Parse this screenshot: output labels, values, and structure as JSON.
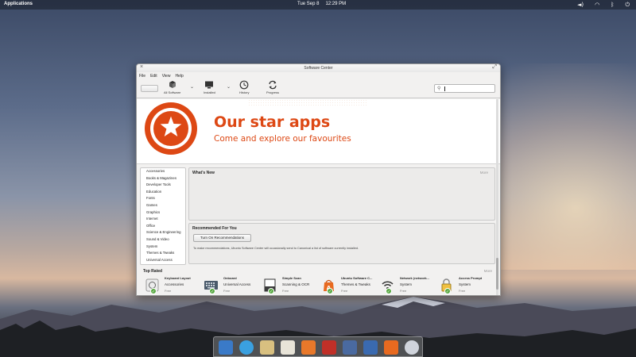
{
  "top_panel": {
    "applications_label": "Applications",
    "date": "Tue Sep 8",
    "time": "12:29 PM"
  },
  "window": {
    "title": "Software Center",
    "menu": [
      "File",
      "Edit",
      "View",
      "Help"
    ],
    "toolbar": {
      "all_software_label": "All Software",
      "installed_label": "Installed",
      "history_label": "History",
      "progress_label": "Progress"
    },
    "search": {
      "value": ""
    }
  },
  "banner": {
    "headline": "Our star apps",
    "subline": "Come and explore our favourites"
  },
  "categories": [
    "Accessories",
    "Books & Magazines",
    "Developer Tools",
    "Education",
    "Fonts",
    "Games",
    "Graphics",
    "Internet",
    "Office",
    "Science & Engineering",
    "Sound & Video",
    "System",
    "Themes & Tweaks",
    "Universal Access"
  ],
  "whats_new": {
    "heading": "What's New",
    "more": "More"
  },
  "recommended": {
    "heading": "Recommended For You",
    "button": "Turn On Recommendations",
    "note": "To make recommendations, Ubuntu Software Center will occasionally send to Canonical a list of software currently installed."
  },
  "top_rated": {
    "heading": "Top Rated",
    "more": "More",
    "apps": [
      {
        "name": "Keyboard Layout",
        "category": "Accessories",
        "price": "Free",
        "icon": "keyboard-layout-icon",
        "color": "#e8e8e8"
      },
      {
        "name": "Onboard",
        "category": "Universal Access",
        "price": "Free",
        "icon": "onboard-keyboard-icon",
        "color": "#4a5a6a"
      },
      {
        "name": "Simple Scan",
        "category": "Scanning & OCR",
        "price": "Free",
        "icon": "scanner-icon",
        "color": "#3a3a3a"
      },
      {
        "name": "Ubuntu Software C...",
        "category": "Themes & Tweaks",
        "price": "Free",
        "icon": "software-center-icon",
        "color": "#e86a20"
      },
      {
        "name": "Network (network...",
        "category": "System",
        "price": "Free",
        "icon": "wifi-icon",
        "color": "#333333"
      },
      {
        "name": "Access Prompt",
        "category": "System",
        "price": "Free",
        "icon": "access-prompt-icon",
        "color": "#f0c040"
      }
    ]
  },
  "dock": [
    {
      "name": "multitasking-view-icon",
      "color": "#3a7ac8"
    },
    {
      "name": "web-browser-icon",
      "color": "#3aa0e0"
    },
    {
      "name": "mail-icon",
      "color": "#d8c080"
    },
    {
      "name": "calendar-icon",
      "color": "#e8e4d8"
    },
    {
      "name": "music-icon",
      "color": "#e8782a"
    },
    {
      "name": "videos-icon",
      "color": "#c03028"
    },
    {
      "name": "photos-icon",
      "color": "#4a6aa0"
    },
    {
      "name": "settings-icon",
      "color": "#3a6ab0"
    },
    {
      "name": "app-center-icon",
      "color": "#e86a20"
    },
    {
      "name": "disc-icon",
      "color": "#d0d4dc"
    }
  ],
  "colors": {
    "accent": "#dd4814",
    "installed_check": "#57a840"
  }
}
